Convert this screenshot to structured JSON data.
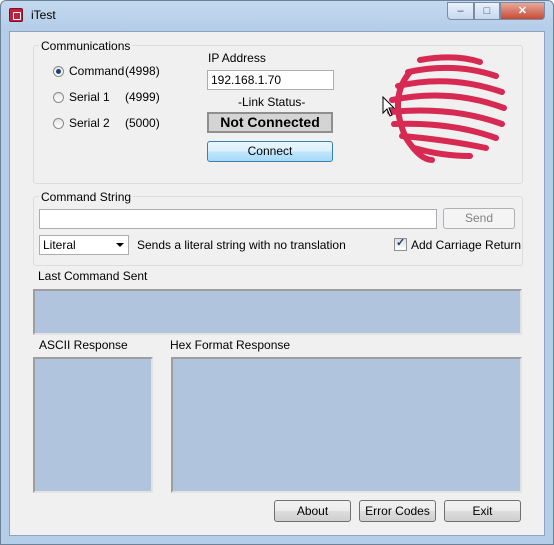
{
  "window": {
    "title": "iTest",
    "controls": {
      "minimize": "–",
      "maximize": "□",
      "close": "✕"
    }
  },
  "communications": {
    "label": "Communications",
    "options": [
      {
        "label": "Command",
        "port": "(4998)",
        "selected": true
      },
      {
        "label": "Serial 1",
        "port": "(4999)",
        "selected": false
      },
      {
        "label": "Serial 2",
        "port": "(5000)",
        "selected": false
      }
    ],
    "ip_label": "IP Address",
    "ip_value": "192.168.1.70",
    "link_status_label": "-Link Status-",
    "link_status": "Not Connected",
    "connect_button": "Connect"
  },
  "command_string": {
    "label": "Command String",
    "value": "",
    "send_button": "Send",
    "mode": "Literal",
    "mode_description": "Sends a literal string with no translation",
    "carriage_return_label": "Add Carriage Return",
    "carriage_return_checked": true
  },
  "last_command": {
    "label": "Last Command Sent"
  },
  "ascii_response": {
    "label": "ASCII Response"
  },
  "hex_response": {
    "label": "Hex Format Response"
  },
  "buttons": {
    "about": "About",
    "error_codes": "Error Codes",
    "exit": "Exit"
  },
  "colors": {
    "panel_bg": "#b0c4de",
    "logo": "#d62a52",
    "window_frame": "#b4cde8"
  },
  "icons": [
    "app-icon",
    "logo-icon",
    "cursor-icon",
    "dropdown-arrow-icon",
    "check-icon"
  ]
}
